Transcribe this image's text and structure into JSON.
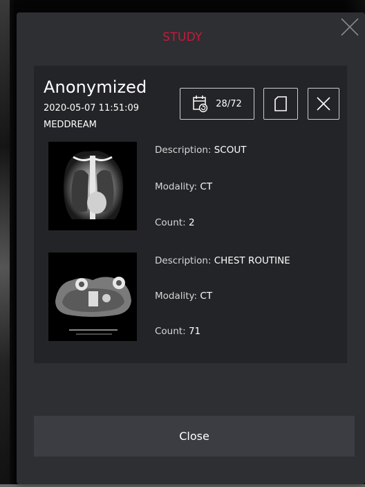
{
  "dialog": {
    "title": "STUDY",
    "close_button_label": "Close"
  },
  "study": {
    "patient_name": "Anonymized",
    "datetime": "2020-05-07 11:51:09",
    "institution": "MEDDREAM",
    "series_position": "28/72"
  },
  "labels": {
    "description": "Description:",
    "modality": "Modality:",
    "count": "Count:"
  },
  "series": [
    {
      "description": "SCOUT",
      "modality": "CT",
      "count": "2"
    },
    {
      "description": "CHEST ROUTINE",
      "modality": "CT",
      "count": "71"
    }
  ],
  "colors": {
    "title_accent": "#c8193c",
    "dialog_bg": "#2e2f32",
    "card_bg": "#232427",
    "footer_button_bg": "#3c3d43"
  },
  "icons": {
    "calendar": "calendar-refresh-icon",
    "square": "square-icon",
    "close": "close-icon"
  }
}
